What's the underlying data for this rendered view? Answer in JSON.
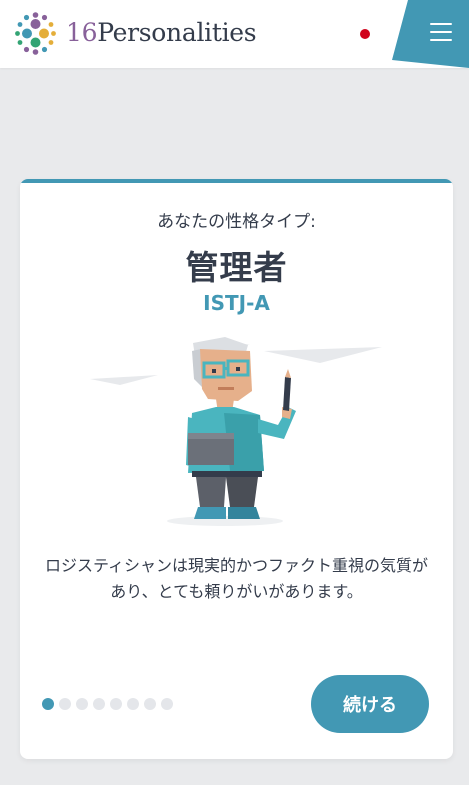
{
  "header": {
    "brand_number": "16",
    "brand_name": "Personalities",
    "language_icon": "japan-flag-icon",
    "menu_icon": "hamburger-menu-icon"
  },
  "result": {
    "subtitle": "あなたの性格タイプ:",
    "type_name": "管理者",
    "type_code": "ISTJ-A",
    "description": "ロジスティシャンは現実的かつファクト重視の気質があり、とても頼りがいがあります。"
  },
  "pagination": {
    "total": 8,
    "current": 1
  },
  "actions": {
    "continue_label": "続ける"
  },
  "colors": {
    "accent": "#4298b4",
    "brand_purple": "#88619a",
    "text": "#343c4b",
    "flag_red": "#d0021b"
  }
}
